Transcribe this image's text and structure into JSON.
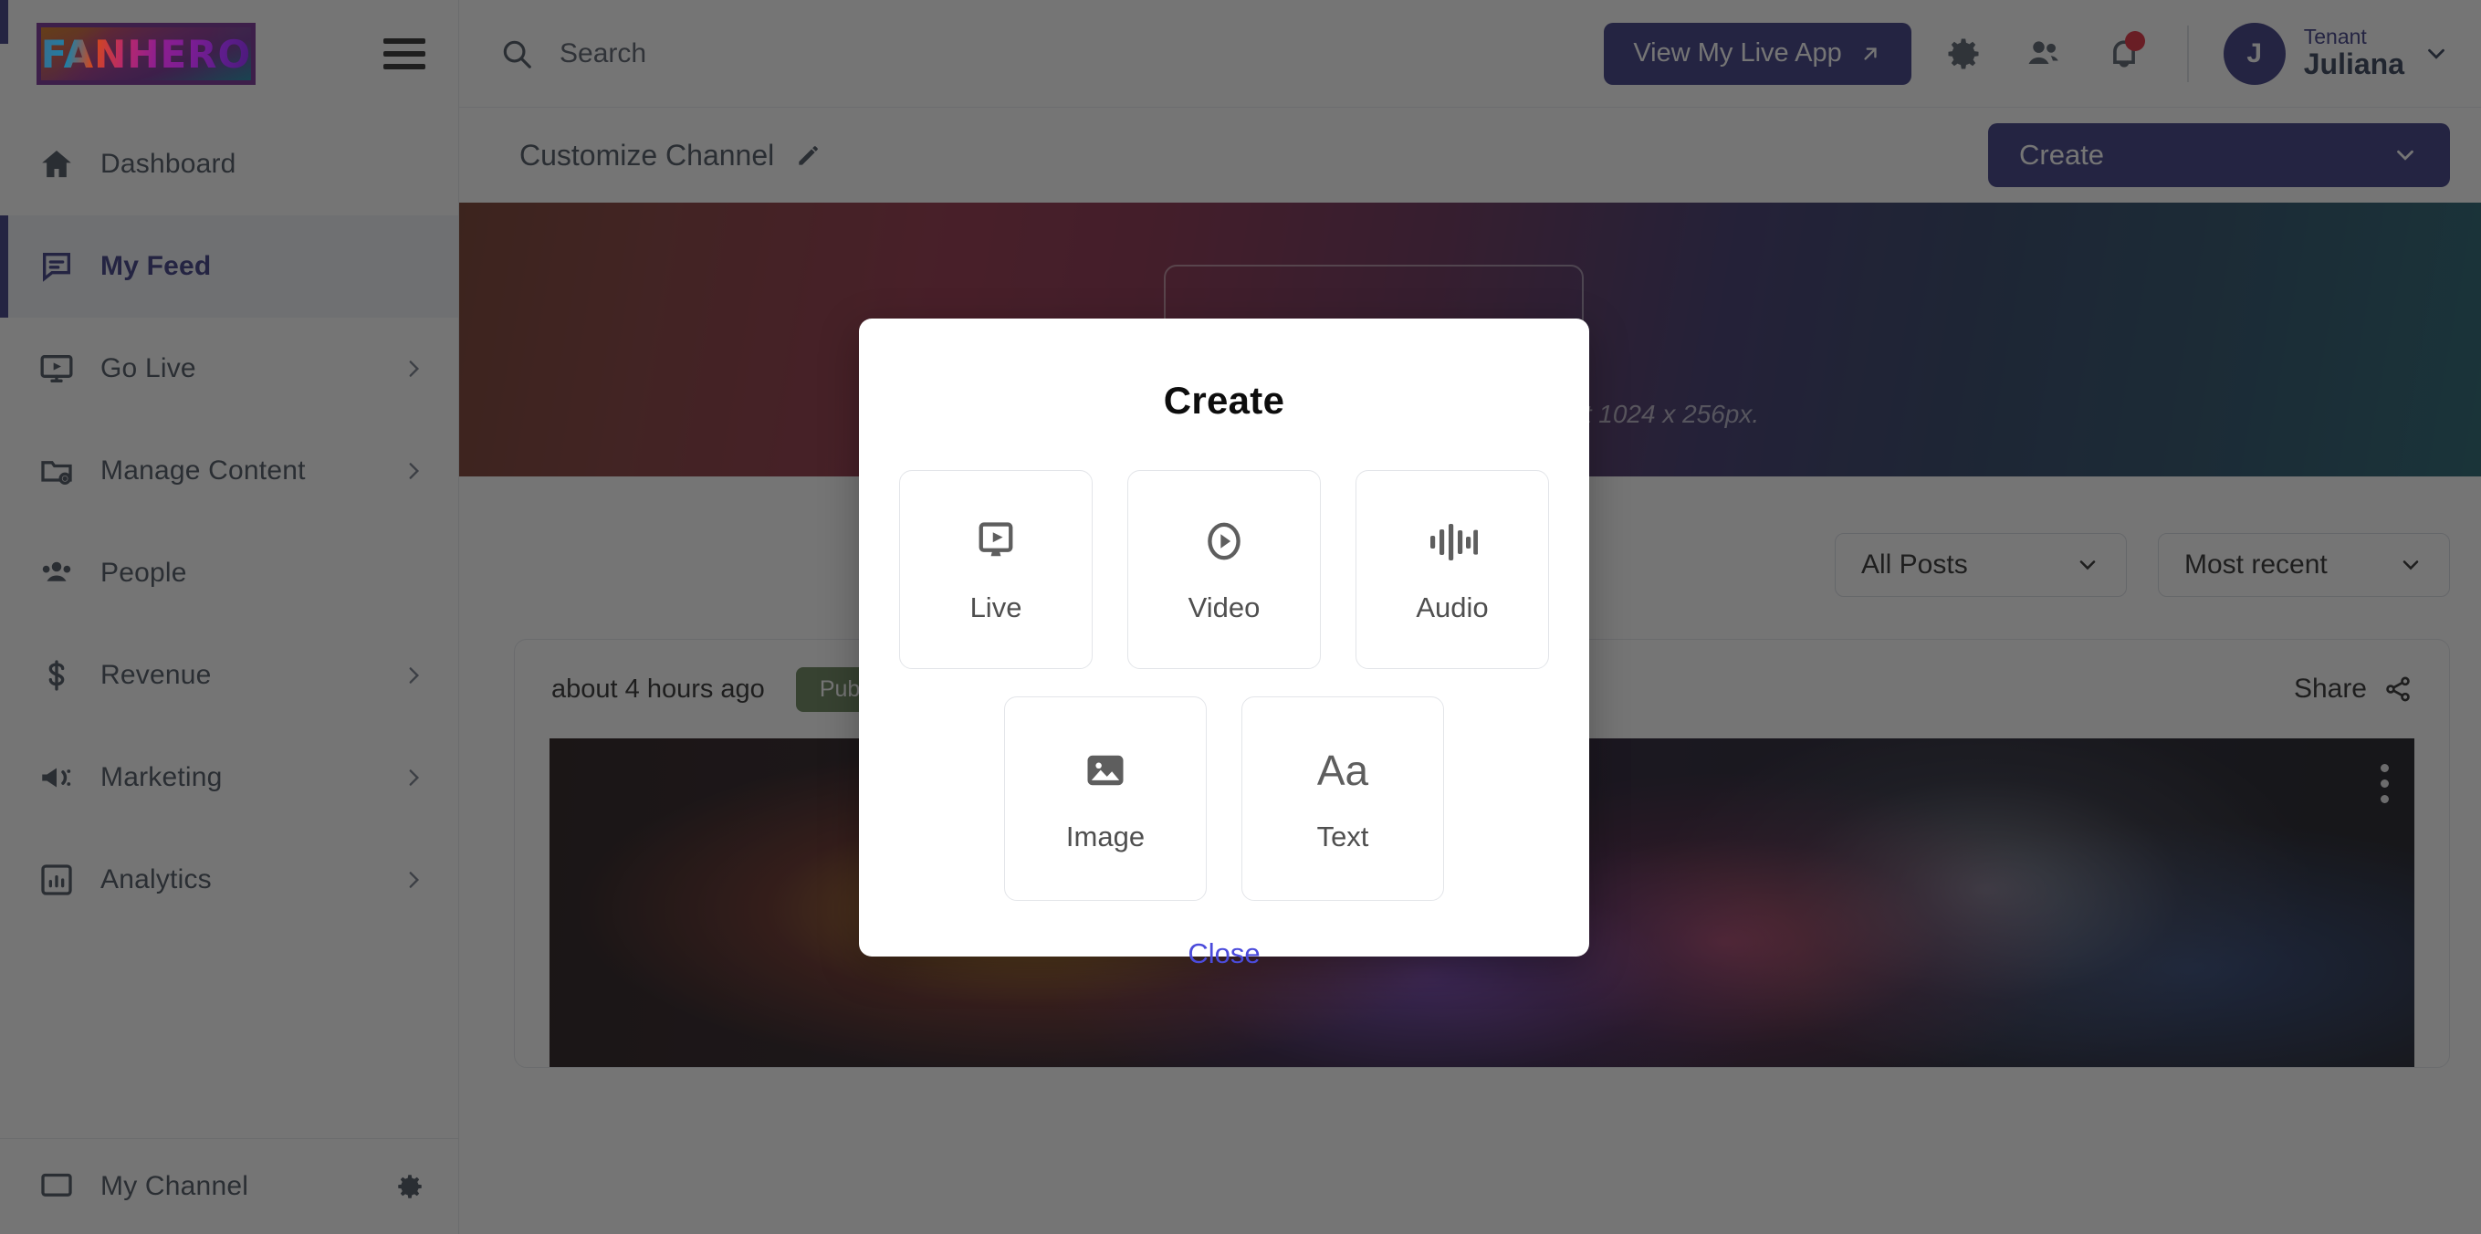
{
  "brand": {
    "logo_text": "FANHERO",
    "accent": "#2b2a7a"
  },
  "sidebar": {
    "items": [
      {
        "label": "Dashboard",
        "icon": "home-icon",
        "has_chevron": false,
        "active": false
      },
      {
        "label": "My Feed",
        "icon": "feed-icon",
        "has_chevron": false,
        "active": true
      },
      {
        "label": "Go Live",
        "icon": "go-live-icon",
        "has_chevron": true,
        "active": false
      },
      {
        "label": "Manage Content",
        "icon": "folder-settings-icon",
        "has_chevron": true,
        "active": false
      },
      {
        "label": "People",
        "icon": "people-icon",
        "has_chevron": false,
        "active": false
      },
      {
        "label": "Revenue",
        "icon": "dollar-icon",
        "has_chevron": true,
        "active": false
      },
      {
        "label": "Marketing",
        "icon": "megaphone-icon",
        "has_chevron": true,
        "active": false
      },
      {
        "label": "Analytics",
        "icon": "analytics-icon",
        "has_chevron": true,
        "active": false
      }
    ],
    "bottom": {
      "label": "My Channel",
      "icon": "screen-icon",
      "trailing_icon": "gear-icon"
    }
  },
  "topbar": {
    "search_placeholder": "Search",
    "search_value": "",
    "search_icon": "search-icon",
    "live_app_button": "View My Live App",
    "live_app_icon": "external-link-icon",
    "settings_icon": "gear-icon",
    "people_icon": "people-icon",
    "notifications_icon": "bell-icon",
    "notifications_has_unread": true,
    "user": {
      "avatar_initial": "J",
      "role": "Tenant",
      "name": "Juliana",
      "chevron": "chevron-down-icon"
    }
  },
  "channel": {
    "title": "Customize Channel",
    "edit_icon": "pencil-icon",
    "create_button": "Create",
    "create_chevron": "chevron-down-icon",
    "banner_note": "Recommended banner size is at least 1024 x 256px."
  },
  "filters": {
    "post_filter": {
      "value": "All Posts",
      "chevron": "chevron-down-icon"
    },
    "sort_filter": {
      "value": "Most recent",
      "chevron": "chevron-down-icon"
    }
  },
  "post": {
    "timestamp": "about 4 hours ago",
    "badge": "Published",
    "share_label": "Share",
    "share_icon": "share-icon",
    "menu_icon": "kebab-menu-icon"
  },
  "modal": {
    "title": "Create",
    "options_row1": [
      {
        "label": "Live",
        "icon": "monitor-play-icon"
      },
      {
        "label": "Video",
        "icon": "play-circle-icon"
      },
      {
        "label": "Audio",
        "icon": "audio-waveform-icon"
      }
    ],
    "options_row2": [
      {
        "label": "Image",
        "icon": "image-icon"
      },
      {
        "label": "Text",
        "icon": "text-aa-icon",
        "glyph": "Aa"
      }
    ],
    "close_label": "Close"
  }
}
